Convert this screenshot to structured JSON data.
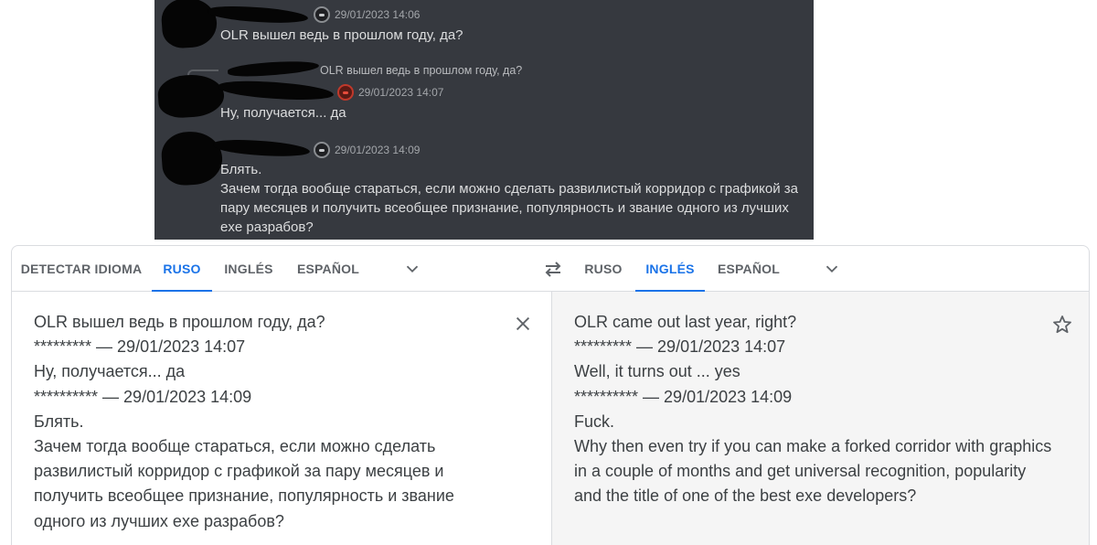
{
  "chat": {
    "messages": [
      {
        "timestamp": "29/01/2023 14:06",
        "lines": [
          "OLR вышел ведь в прошлом году, да?"
        ]
      },
      {
        "reply_quote": "OLR вышел ведь в прошлом году, да?",
        "timestamp": "29/01/2023 14:07",
        "lines": [
          "Ну, получается... да"
        ]
      },
      {
        "timestamp": "29/01/2023 14:09",
        "lines": [
          "Блять.",
          "Зачем тогда вообще стараться, если можно сделать развилистый корридор с графикой за",
          "пару месяцев и получить всеобщее признание, популярность и звание одного из лучших",
          "exe разрабов?"
        ]
      }
    ]
  },
  "translator": {
    "source_tabs": [
      "DETECTAR IDIOMA",
      "RUSO",
      "INGLÉS",
      "ESPAÑOL"
    ],
    "target_tabs": [
      "RUSO",
      "INGLÉS",
      "ESPAÑOL"
    ],
    "source_active": "RUSO",
    "target_active": "INGLÉS",
    "source_lines": [
      "OLR вышел ведь в прошлом году, да?",
      "********* — 29/01/2023 14:07",
      "Ну, получается... да",
      "********** — 29/01/2023 14:09",
      "Блять.",
      "Зачем тогда вообще стараться, если можно сделать",
      "развилистый корридор с графикой за пару месяцев и",
      "получить всеобщее признание, популярность и звание",
      "одного из лучших exe разрабов?"
    ],
    "target_lines": [
      "OLR came out last year, right?",
      "********* — 29/01/2023 14:07",
      "Well, it turns out ... yes",
      "********** — 29/01/2023 14:09",
      "Fuck.",
      "Why then even try if you can make a forked corridor with graphics",
      "in a couple of months and get universal recognition, popularity",
      "and the title of one of the best exe developers?"
    ],
    "icons": {
      "swap": "swap-languages-icon",
      "more_source": "chevron-down-icon",
      "more_target": "chevron-down-icon",
      "clear": "close-icon",
      "save": "star-icon"
    },
    "colors": {
      "accent": "#1a73e8",
      "text": "#3c4043",
      "muted": "#5f6368"
    }
  }
}
